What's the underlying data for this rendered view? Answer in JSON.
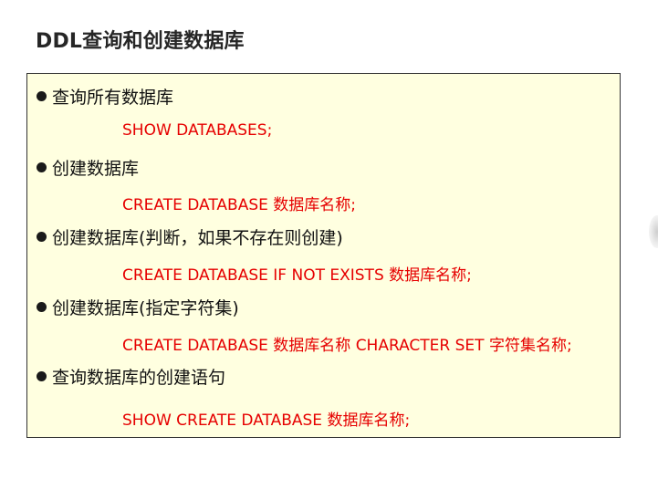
{
  "title": "DDL查询和创建数据库",
  "items": [
    {
      "label": "查询所有数据库",
      "command": "SHOW DATABASES;"
    },
    {
      "label": "创建数据库",
      "command": "CREATE DATABASE 数据库名称;"
    },
    {
      "label": "创建数据库(判断，如果不存在则创建)",
      "command": "CREATE DATABASE IF NOT EXISTS 数据库名称;"
    },
    {
      "label": "创建数据库(指定字符集)",
      "command": "CREATE DATABASE 数据库名称 CHARACTER SET 字符集名称;"
    },
    {
      "label": "查询数据库的创建语句",
      "command": "SHOW CREATE DATABASE 数据库名称;"
    }
  ],
  "colors": {
    "box_background": "#ffffe0",
    "command_text": "#e60000",
    "title_text": "#262626"
  }
}
